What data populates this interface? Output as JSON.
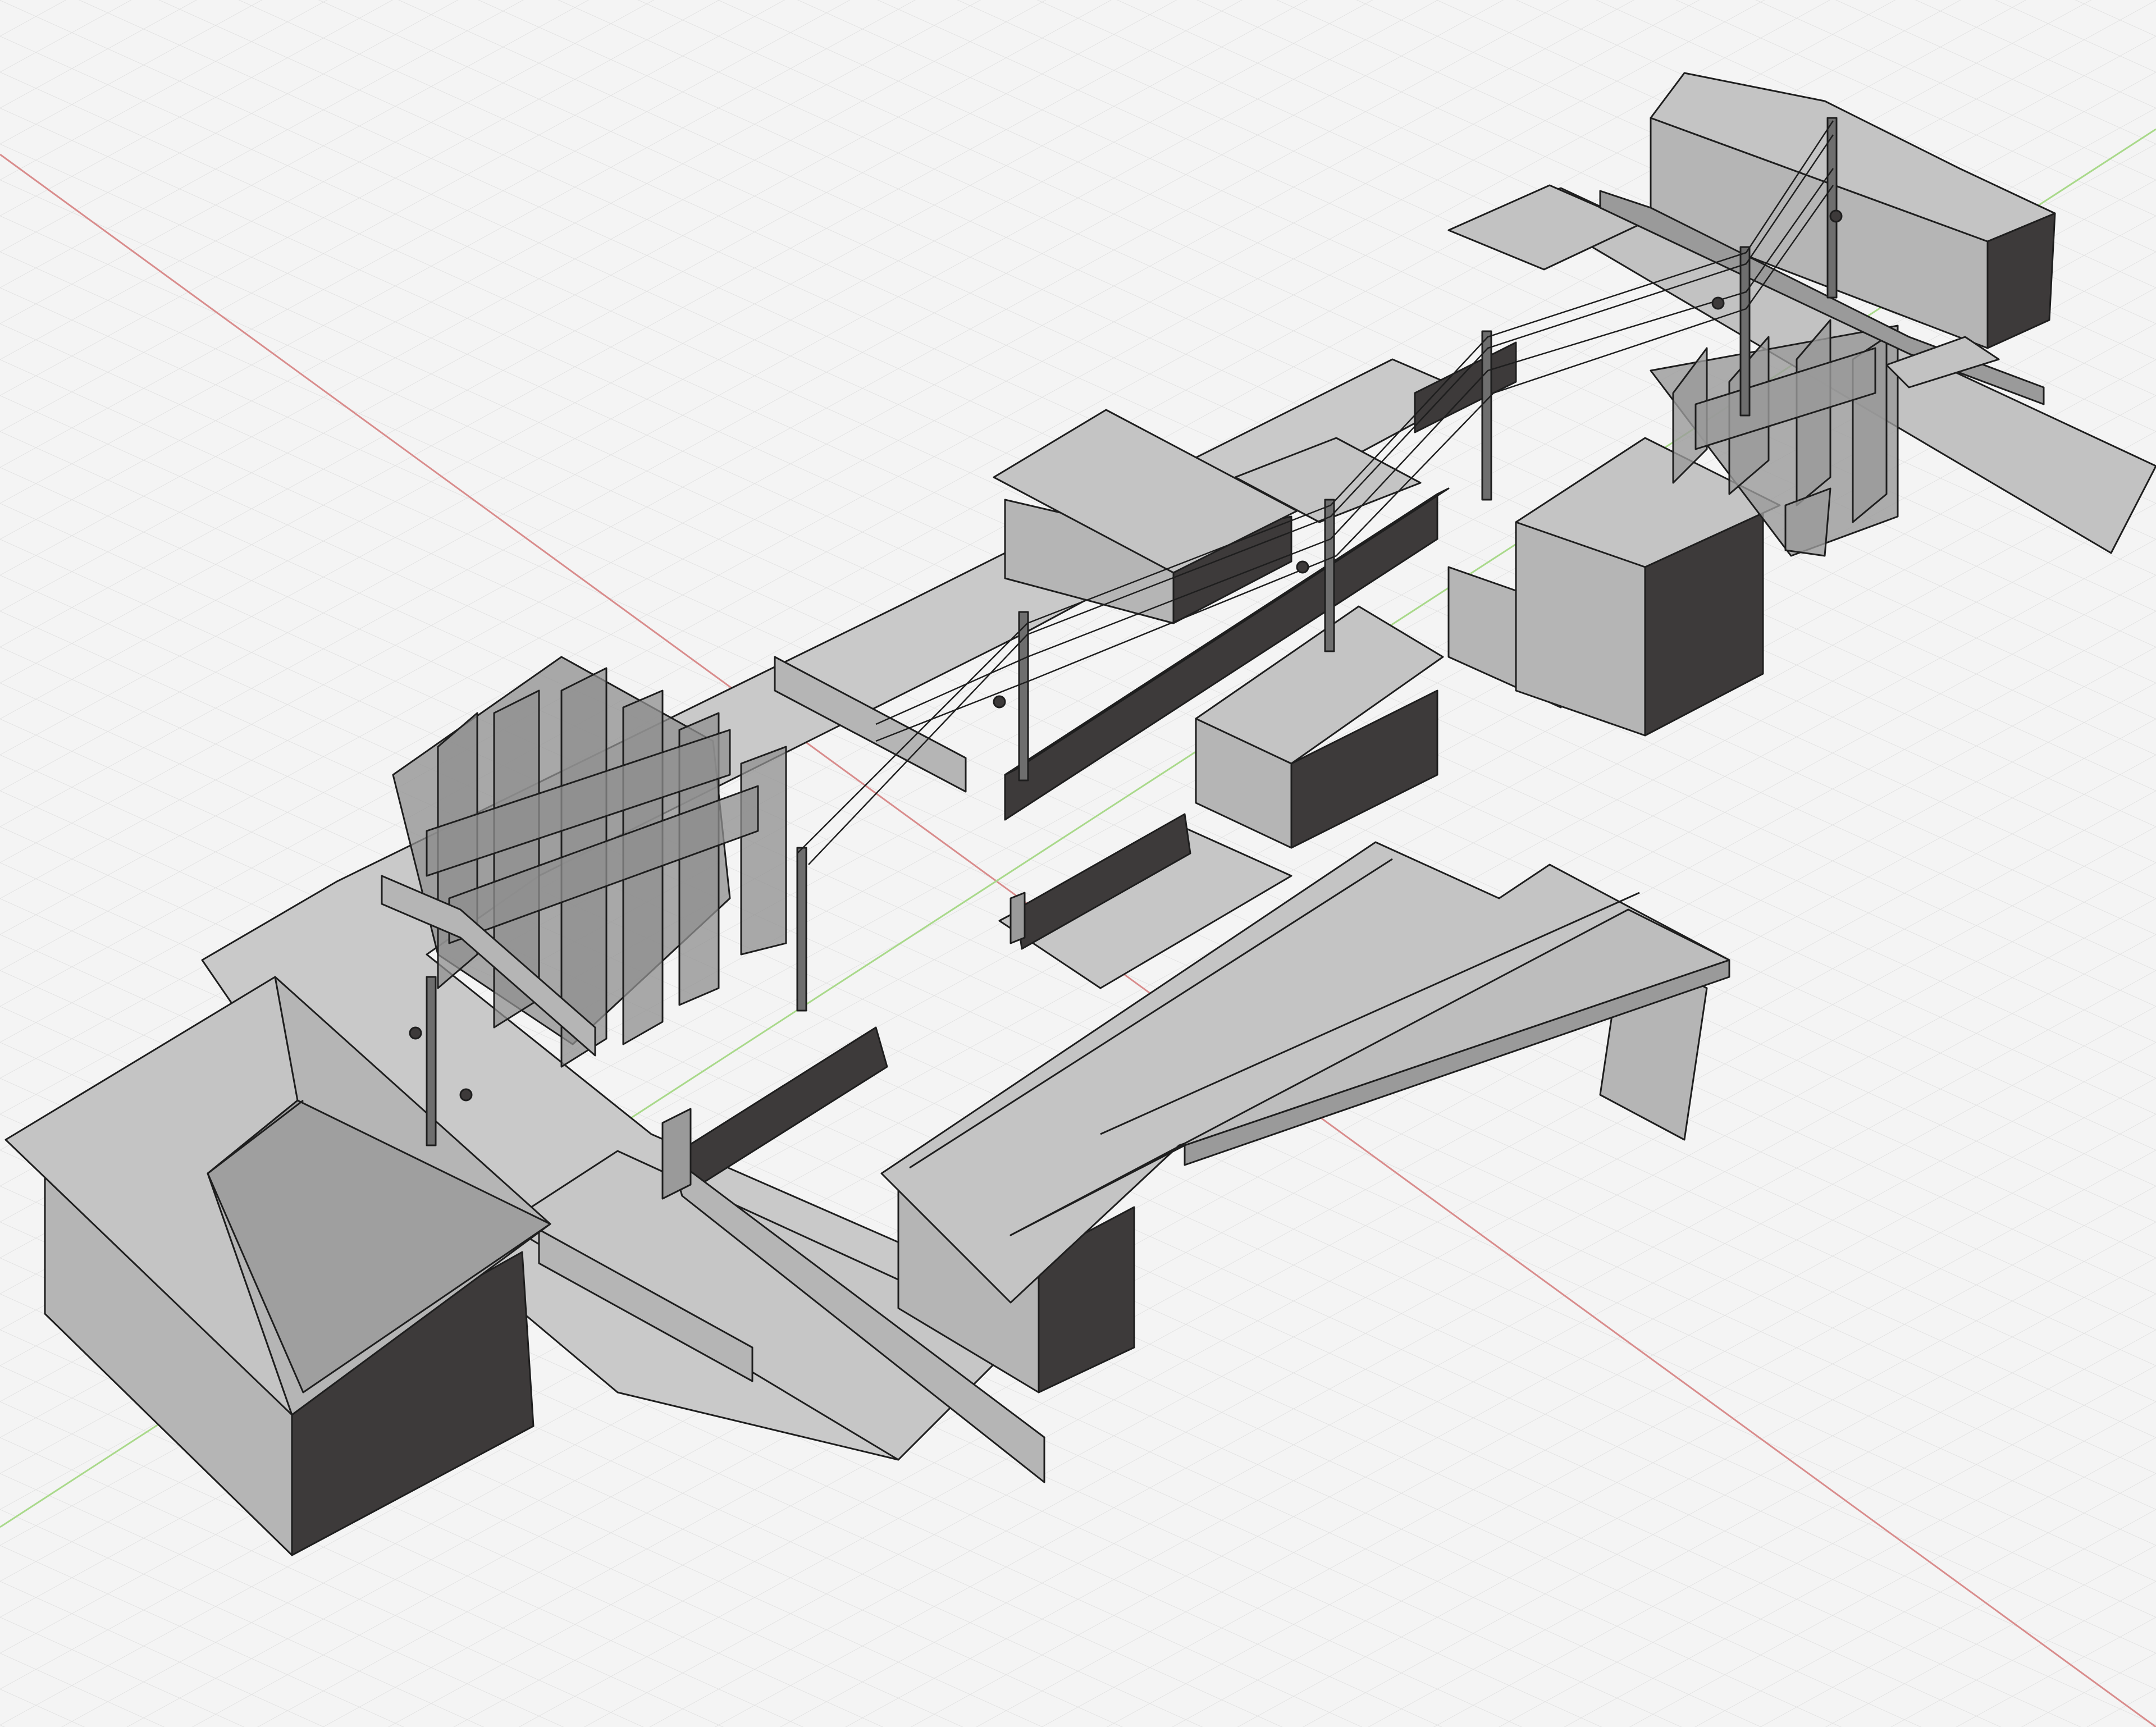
{
  "viewport": {
    "background": "#f4f4f4",
    "grid_minor_color": "#e2e2e2",
    "grid_major_color": "#d4d4d4",
    "axis_x_color": "#d98c8c",
    "axis_y_color": "#9ccf7a"
  },
  "materials": {
    "roof_light": "#c4c4c4",
    "wall_light": "#b5b5b5",
    "wall_mid": "#9a9a9a",
    "wall_dark": "#3d3a3a",
    "ground": "#c9c9c9",
    "edge": "#1e1e1e"
  },
  "scene_objects": [
    "house-hip-roof-bottom-left",
    "warehouse-large-roof-center",
    "tree-cluster-left",
    "tree-cluster-right",
    "two-story-building-top-right",
    "boxy-building-right",
    "box-building-center",
    "shed-center-top",
    "utility-poles",
    "power-lines",
    "perimeter-walls",
    "street-lamps",
    "ground-slabs"
  ]
}
